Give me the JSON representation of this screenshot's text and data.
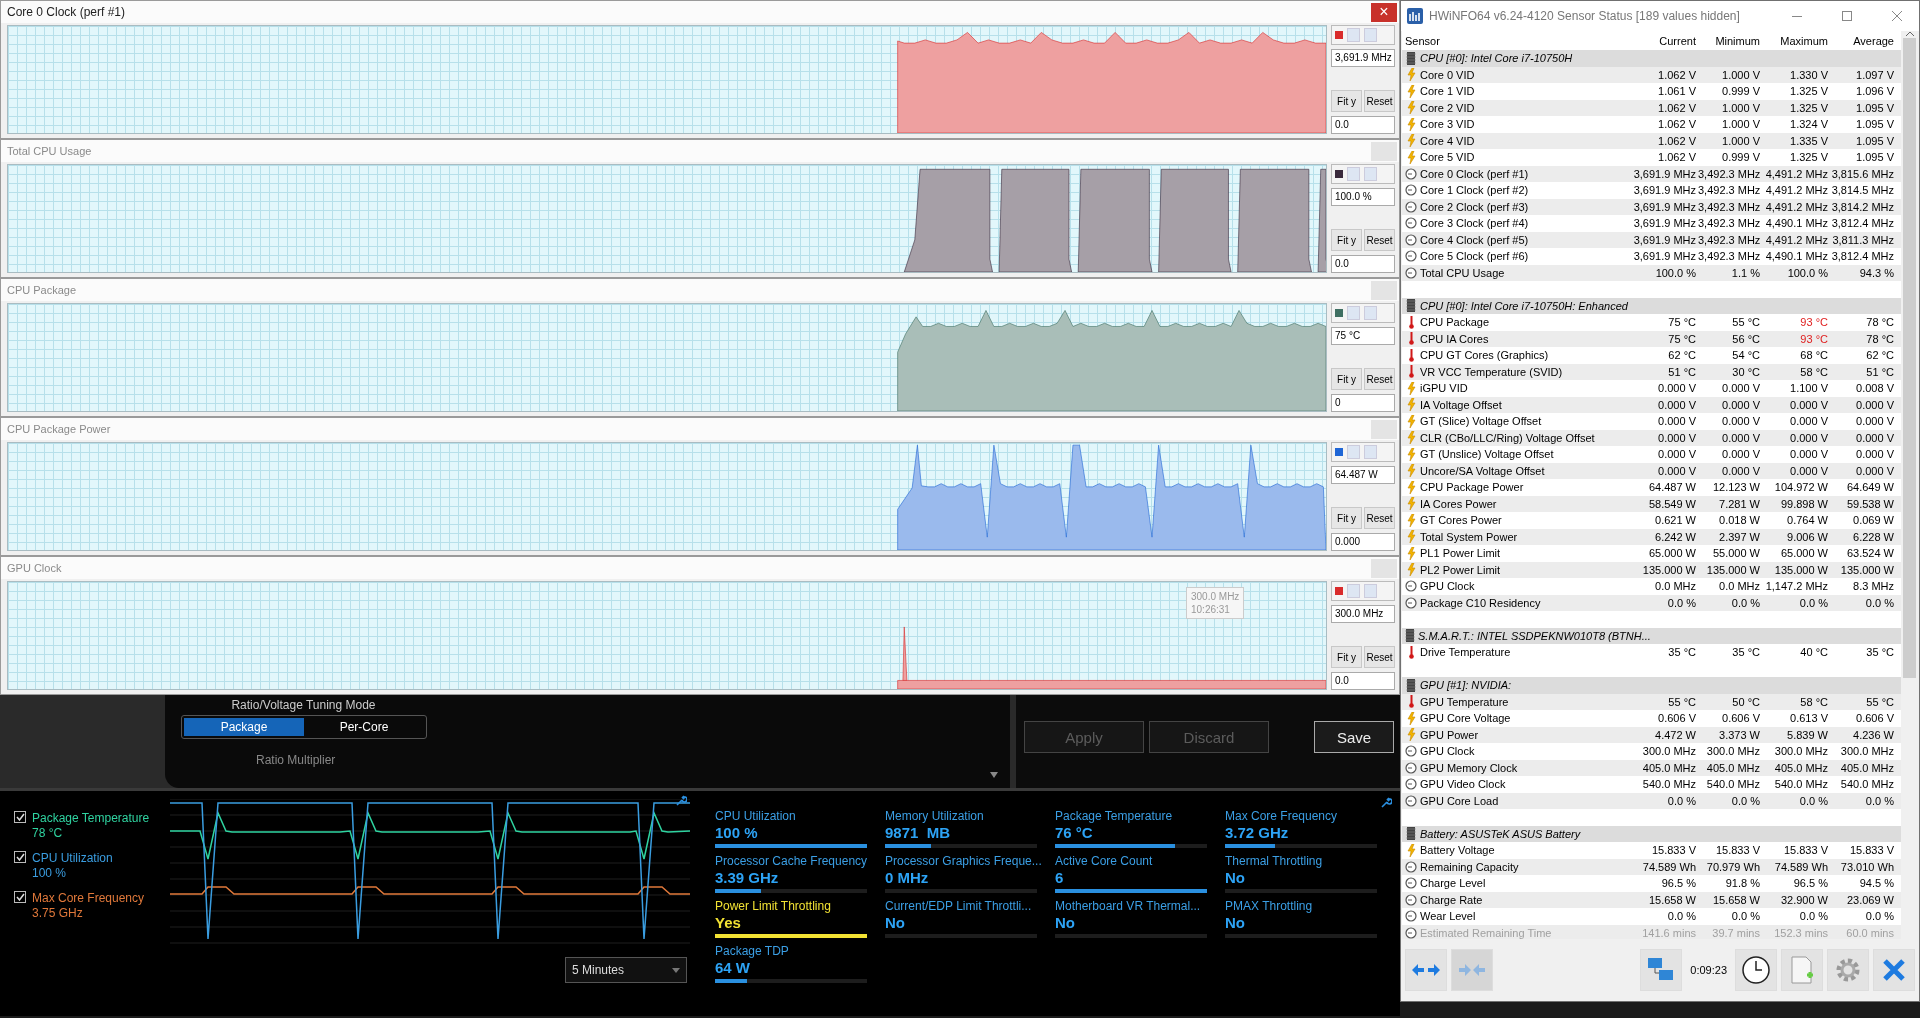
{
  "panels": [
    {
      "kind": "clock",
      "title": "Core 0 Clock (perf #1)",
      "close": "×",
      "color": "#d92b2b",
      "value": "3,691.9 MHz",
      "buttons": [
        "Fit y",
        "Reset"
      ],
      "min": "0.0"
    },
    {
      "kind": "usage",
      "title": "Total CPU Usage",
      "color": "#3a2a3c",
      "value": "100.0 %",
      "buttons": [
        "Fit y",
        "Reset"
      ],
      "min": "0.0"
    },
    {
      "kind": "temp",
      "title": "CPU Package",
      "color": "#3f6f62",
      "value": "75 °C",
      "buttons": [
        "Fit y",
        "Reset"
      ],
      "min": "0"
    },
    {
      "kind": "power",
      "title": "CPU Package Power",
      "color": "#1f66d6",
      "value": "64.487 W",
      "buttons": [
        "Fit y",
        "Reset"
      ],
      "min": "0.000"
    },
    {
      "kind": "gpu",
      "title": "GPU Clock",
      "color": "#d92b2b",
      "value": "300.0 MHz",
      "buttons": [
        "Fit y",
        "Reset"
      ],
      "min": "0.0",
      "tooltip": [
        "300.0 MHz",
        "10:26:31"
      ]
    }
  ],
  "xtu": {
    "tuning_mode": {
      "label": "Ratio/Voltage Tuning Mode",
      "options": [
        {
          "label": "Package",
          "selected": true
        },
        {
          "label": "Per-Core",
          "selected": false
        }
      ]
    },
    "ratio_label": "Ratio Multiplier",
    "buttons": [
      {
        "label": "Apply",
        "disabled": true
      },
      {
        "label": "Discard",
        "disabled": true
      },
      {
        "label": "Save",
        "disabled": false
      }
    ]
  },
  "monitor": {
    "legend": [
      {
        "label": "Package Temperature",
        "value": "78 °C",
        "color": "#2fd3a0",
        "checked": true
      },
      {
        "label": "CPU Utilization",
        "value": "100 %",
        "color": "#3a9de0",
        "checked": true
      },
      {
        "label": "Max Core Frequency",
        "value": "3.75 GHz",
        "color": "#e0783a",
        "checked": true
      }
    ],
    "time_range": "5 Minutes",
    "metrics": [
      {
        "label": "CPU Utilization",
        "value": "100 %",
        "level": 1.0,
        "alert": false
      },
      {
        "label": "Memory Utilization",
        "value": "9871  MB",
        "level": 0.3,
        "alert": false
      },
      {
        "label": "Package Temperature",
        "value": "76 °C",
        "level": 0.79,
        "alert": false
      },
      {
        "label": "Max Core Frequency",
        "value": "3.72 GHz",
        "level": 0.33,
        "alert": false
      },
      {
        "label": "Processor Cache Frequency",
        "value": "3.39 GHz",
        "level": 0.3,
        "alert": false
      },
      {
        "label": "Processor Graphics Freque...",
        "value": "0 MHz",
        "level": 0,
        "alert": false
      },
      {
        "label": "Active Core Count",
        "value": "6",
        "level": 1.0,
        "alert": false
      },
      {
        "label": "Thermal Throttling",
        "value": "No",
        "level": 0,
        "alert": false
      },
      {
        "label": "Power Limit Throttling",
        "value": "Yes",
        "level": 1.0,
        "alert": true
      },
      {
        "label": "Current/EDP Limit Throttli...",
        "value": "No",
        "level": 0,
        "alert": false
      },
      {
        "label": "Motherboard VR Thermal...",
        "value": "No",
        "level": 0,
        "alert": false
      },
      {
        "label": "PMAX Throttling",
        "value": "No",
        "level": 0,
        "alert": false
      },
      {
        "label": "Package TDP",
        "value": "64 W",
        "level": 0.21,
        "alert": false
      }
    ]
  },
  "sensors": {
    "title": "HWiNFO64 v6.24-4120 Sensor Status [189 values hidden]",
    "columns": [
      "Sensor",
      "Current",
      "Minimum",
      "Maximum",
      "Average"
    ],
    "time": "0:09:23",
    "rows": [
      {
        "kind": "group",
        "name": "CPU [#0]: Intel Core i7-10750H"
      },
      {
        "kind": "volt",
        "name": "Core 0 VID",
        "values": [
          "1.062 V",
          "1.000 V",
          "1.330 V",
          "1.097 V"
        ]
      },
      {
        "kind": "volt",
        "name": "Core 1 VID",
        "values": [
          "1.061 V",
          "0.999 V",
          "1.325 V",
          "1.096 V"
        ]
      },
      {
        "kind": "volt",
        "name": "Core 2 VID",
        "values": [
          "1.062 V",
          "1.000 V",
          "1.325 V",
          "1.095 V"
        ]
      },
      {
        "kind": "volt",
        "name": "Core 3 VID",
        "values": [
          "1.062 V",
          "1.000 V",
          "1.324 V",
          "1.095 V"
        ]
      },
      {
        "kind": "volt",
        "name": "Core 4 VID",
        "values": [
          "1.062 V",
          "1.000 V",
          "1.335 V",
          "1.095 V"
        ]
      },
      {
        "kind": "volt",
        "name": "Core 5 VID",
        "values": [
          "1.062 V",
          "0.999 V",
          "1.325 V",
          "1.095 V"
        ]
      },
      {
        "kind": "clock",
        "name": "Core 0 Clock (perf #1)",
        "values": [
          "3,691.9 MHz",
          "3,492.3 MHz",
          "4,491.2 MHz",
          "3,815.6 MHz"
        ]
      },
      {
        "kind": "clock",
        "name": "Core 1 Clock (perf #2)",
        "values": [
          "3,691.9 MHz",
          "3,492.3 MHz",
          "4,491.2 MHz",
          "3,814.5 MHz"
        ]
      },
      {
        "kind": "clock",
        "name": "Core 2 Clock (perf #3)",
        "values": [
          "3,691.9 MHz",
          "3,492.3 MHz",
          "4,491.2 MHz",
          "3,814.2 MHz"
        ]
      },
      {
        "kind": "clock",
        "name": "Core 3 Clock (perf #4)",
        "values": [
          "3,691.9 MHz",
          "3,492.3 MHz",
          "4,490.1 MHz",
          "3,812.4 MHz"
        ]
      },
      {
        "kind": "clock",
        "name": "Core 4 Clock (perf #5)",
        "values": [
          "3,691.9 MHz",
          "3,492.3 MHz",
          "4,491.2 MHz",
          "3,811.3 MHz"
        ]
      },
      {
        "kind": "clock",
        "name": "Core 5 Clock (perf #6)",
        "values": [
          "3,691.9 MHz",
          "3,492.3 MHz",
          "4,490.1 MHz",
          "3,812.4 MHz"
        ]
      },
      {
        "kind": "clock",
        "name": "Total CPU Usage",
        "values": [
          "100.0 %",
          "1.1 %",
          "100.0 %",
          "94.3 %"
        ]
      },
      {
        "kind": "spacer"
      },
      {
        "kind": "group",
        "name": "CPU [#0]: Intel Core i7-10750H: Enhanced"
      },
      {
        "kind": "temp",
        "name": "CPU Package",
        "values": [
          "75 °C",
          "55 °C",
          "93 °C",
          "78 °C"
        ],
        "max_alert": true
      },
      {
        "kind": "temp",
        "name": "CPU IA Cores",
        "values": [
          "75 °C",
          "56 °C",
          "93 °C",
          "78 °C"
        ],
        "max_alert": true
      },
      {
        "kind": "temp",
        "name": "CPU GT Cores (Graphics)",
        "values": [
          "62 °C",
          "54 °C",
          "68 °C",
          "62 °C"
        ]
      },
      {
        "kind": "temp",
        "name": "VR VCC Temperature (SVID)",
        "values": [
          "51 °C",
          "30 °C",
          "58 °C",
          "51 °C"
        ]
      },
      {
        "kind": "volt",
        "name": "iGPU VID",
        "values": [
          "0.000 V",
          "0.000 V",
          "1.100 V",
          "0.008 V"
        ]
      },
      {
        "kind": "volt",
        "name": "IA Voltage Offset",
        "values": [
          "0.000 V",
          "0.000 V",
          "0.000 V",
          "0.000 V"
        ]
      },
      {
        "kind": "volt",
        "name": "GT (Slice) Voltage Offset",
        "values": [
          "0.000 V",
          "0.000 V",
          "0.000 V",
          "0.000 V"
        ]
      },
      {
        "kind": "volt",
        "name": "CLR (CBo/LLC/Ring) Voltage Offset",
        "values": [
          "0.000 V",
          "0.000 V",
          "0.000 V",
          "0.000 V"
        ]
      },
      {
        "kind": "volt",
        "name": "GT (Unslice) Voltage Offset",
        "values": [
          "0.000 V",
          "0.000 V",
          "0.000 V",
          "0.000 V"
        ]
      },
      {
        "kind": "volt",
        "name": "Uncore/SA Voltage Offset",
        "values": [
          "0.000 V",
          "0.000 V",
          "0.000 V",
          "0.000 V"
        ]
      },
      {
        "kind": "volt",
        "name": "CPU Package Power",
        "values": [
          "64.487 W",
          "12.123 W",
          "104.972 W",
          "64.649 W"
        ]
      },
      {
        "kind": "volt",
        "name": "IA Cores Power",
        "values": [
          "58.549 W",
          "7.281 W",
          "99.898 W",
          "59.538 W"
        ]
      },
      {
        "kind": "volt",
        "name": "GT Cores Power",
        "values": [
          "0.621 W",
          "0.018 W",
          "0.764 W",
          "0.069 W"
        ]
      },
      {
        "kind": "volt",
        "name": "Total System Power",
        "values": [
          "6.242 W",
          "2.397 W",
          "9.006 W",
          "6.228 W"
        ]
      },
      {
        "kind": "volt",
        "name": "PL1 Power Limit",
        "values": [
          "65.000 W",
          "55.000 W",
          "65.000 W",
          "63.524 W"
        ]
      },
      {
        "kind": "volt",
        "name": "PL2 Power Limit",
        "values": [
          "135.000 W",
          "135.000 W",
          "135.000 W",
          "135.000 W"
        ]
      },
      {
        "kind": "clock",
        "name": "GPU Clock",
        "values": [
          "0.0 MHz",
          "0.0 MHz",
          "1,147.2 MHz",
          "8.3 MHz"
        ]
      },
      {
        "kind": "clock",
        "name": "Package C10 Residency",
        "values": [
          "0.0 %",
          "0.0 %",
          "0.0 %",
          "0.0 %"
        ]
      },
      {
        "kind": "spacer"
      },
      {
        "kind": "group",
        "name": "S.M.A.R.T.: INTEL SSDPEKNW010T8 (BTNH..."
      },
      {
        "kind": "temp",
        "name": "Drive Temperature",
        "values": [
          "35 °C",
          "35 °C",
          "40 °C",
          "35 °C"
        ]
      },
      {
        "kind": "spacer"
      },
      {
        "kind": "group",
        "name": "GPU [#1]: NVIDIA:"
      },
      {
        "kind": "temp",
        "name": "GPU Temperature",
        "values": [
          "55 °C",
          "50 °C",
          "58 °C",
          "55 °C"
        ]
      },
      {
        "kind": "volt",
        "name": "GPU Core Voltage",
        "values": [
          "0.606 V",
          "0.606 V",
          "0.613 V",
          "0.606 V"
        ]
      },
      {
        "kind": "volt",
        "name": "GPU Power",
        "values": [
          "4.472 W",
          "3.373 W",
          "5.839 W",
          "4.236 W"
        ]
      },
      {
        "kind": "clock",
        "name": "GPU Clock",
        "values": [
          "300.0 MHz",
          "300.0 MHz",
          "300.0 MHz",
          "300.0 MHz"
        ]
      },
      {
        "kind": "clock",
        "name": "GPU Memory Clock",
        "values": [
          "405.0 MHz",
          "405.0 MHz",
          "405.0 MHz",
          "405.0 MHz"
        ]
      },
      {
        "kind": "clock",
        "name": "GPU Video Clock",
        "values": [
          "540.0 MHz",
          "540.0 MHz",
          "540.0 MHz",
          "540.0 MHz"
        ]
      },
      {
        "kind": "clock",
        "name": "GPU Core Load",
        "values": [
          "0.0 %",
          "0.0 %",
          "0.0 %",
          "0.0 %"
        ]
      },
      {
        "kind": "spacer"
      },
      {
        "kind": "group",
        "name": "Battery: ASUSTeK ASUS Battery"
      },
      {
        "kind": "volt",
        "name": "Battery Voltage",
        "values": [
          "15.833 V",
          "15.833 V",
          "15.833 V",
          "15.833 V"
        ]
      },
      {
        "kind": "clock",
        "name": "Remaining Capacity",
        "values": [
          "74.589 Wh",
          "70.979 Wh",
          "74.589 Wh",
          "73.010 Wh"
        ]
      },
      {
        "kind": "clock",
        "name": "Charge Level",
        "values": [
          "96.5 %",
          "91.8 %",
          "96.5 %",
          "94.5 %"
        ]
      },
      {
        "kind": "clock",
        "name": "Charge Rate",
        "values": [
          "15.658 W",
          "15.658 W",
          "32.900 W",
          "23.069 W"
        ]
      },
      {
        "kind": "clock",
        "name": "Wear Level",
        "values": [
          "0.0 %",
          "0.0 %",
          "0.0 %",
          "0.0 %"
        ]
      },
      {
        "kind": "clock",
        "name": "Estimated Remaining Time",
        "values": [
          "141.6 mins",
          "39.7 mins",
          "152.3 mins",
          "60.0 mins"
        ],
        "dimmed": true
      }
    ]
  }
}
